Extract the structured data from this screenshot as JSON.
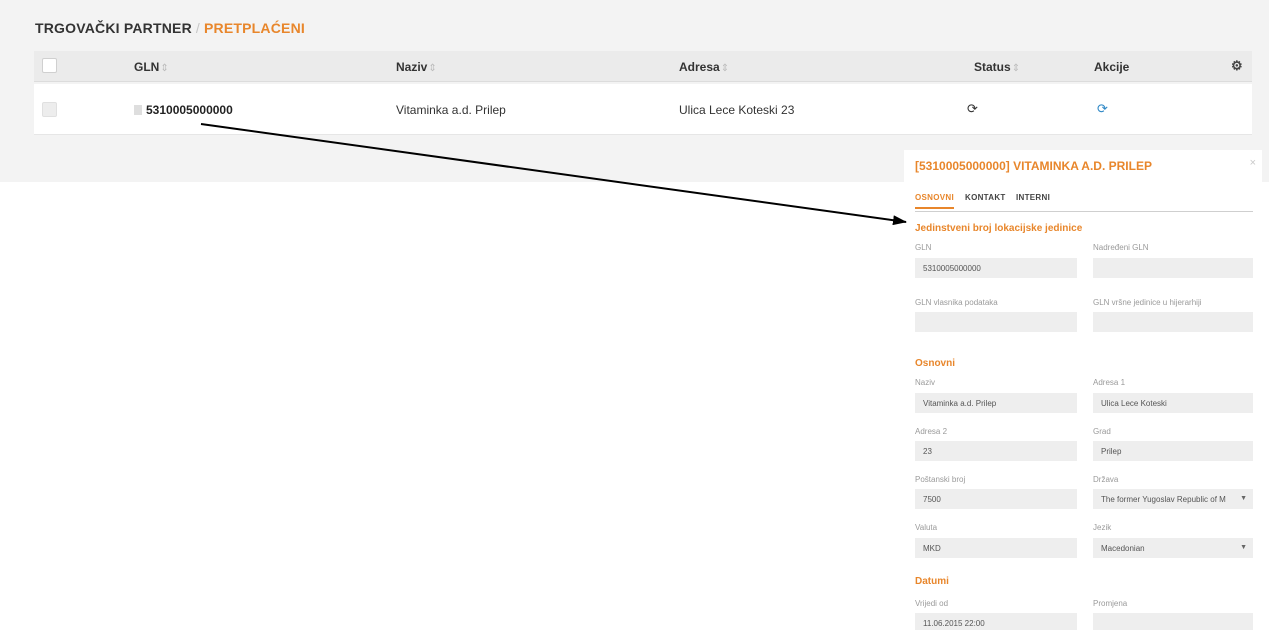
{
  "breadcrumb": {
    "root": "TRGOVAČKI PARTNER",
    "separator": "/",
    "active": "PRETPLAĆENI"
  },
  "table": {
    "columns": {
      "gln": "GLN",
      "naziv": "Naziv",
      "adresa": "Adresa",
      "status": "Status",
      "akcije": "Akcije"
    },
    "sort_glyph": "⇕",
    "rows": [
      {
        "gln": "5310005000000",
        "naziv": "Vitaminka a.d. Prilep",
        "adresa": "Ulica Lece Koteski 23"
      }
    ]
  },
  "detail": {
    "title": "[5310005000000] VITAMINKA A.D. PRILEP",
    "close": "×",
    "tabs": [
      "OSNOVNI",
      "KONTAKT",
      "INTERNI"
    ],
    "sections": {
      "jedinstveni": "Jedinstveni broj lokacijske jedinice",
      "osnovni": "Osnovni",
      "datumi": "Datumi"
    },
    "fields": {
      "gln": {
        "label": "GLN",
        "value": "5310005000000"
      },
      "nadredeni_gln": {
        "label": "Nadređeni GLN",
        "value": ""
      },
      "gln_vlasnika": {
        "label": "GLN vlasnika podataka",
        "value": ""
      },
      "gln_vrsne": {
        "label": "GLN vršne jedinice u hijerarhiji",
        "value": ""
      },
      "naziv": {
        "label": "Naziv",
        "value": "Vitaminka a.d. Prilep"
      },
      "adresa1": {
        "label": "Adresa 1",
        "value": "Ulica Lece Koteski"
      },
      "adresa2": {
        "label": "Adresa 2",
        "value": "23"
      },
      "grad": {
        "label": "Grad",
        "value": "Prilep"
      },
      "postanski": {
        "label": "Poštanski broj",
        "value": "7500"
      },
      "drzava": {
        "label": "Država",
        "value": "The former Yugoslav Republic of M"
      },
      "valuta": {
        "label": "Valuta",
        "value": "MKD"
      },
      "jezik": {
        "label": "Jezik",
        "value": "Macedonian"
      },
      "vrijedi_od": {
        "label": "Vrijedi od",
        "value": "11.06.2015 22:00"
      },
      "promjena": {
        "label": "Promjena",
        "value": ""
      }
    }
  },
  "icons": {
    "status": "refresh-icon",
    "action": "refresh-icon",
    "settings": "gear-icon",
    "file": "file-icon",
    "close": "close-icon",
    "dropdown": "chevron-down-icon"
  },
  "colors": {
    "accent": "#e8862b",
    "action_blue": "#2f88c6"
  }
}
